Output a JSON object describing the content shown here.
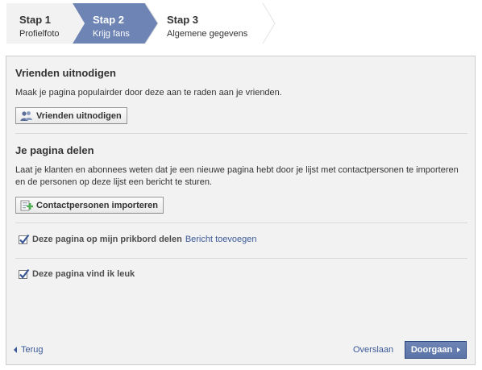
{
  "steps": [
    {
      "title": "Stap 1",
      "subtitle": "Profielfoto",
      "state": "done"
    },
    {
      "title": "Stap 2",
      "subtitle": "Krijg fans",
      "state": "active"
    },
    {
      "title": "Stap 3",
      "subtitle": "Algemene gegevens",
      "state": "upcoming"
    }
  ],
  "invite": {
    "title": "Vrienden uitnodigen",
    "text": "Maak je pagina populairder door deze aan te raden aan je vrienden.",
    "button_label": "Vrienden uitnodigen"
  },
  "share": {
    "title": "Je pagina delen",
    "text": "Laat je klanten en abonnees weten dat je een nieuwe pagina hebt door je lijst met contactpersonen te importeren en de personen op deze lijst een bericht te sturen.",
    "button_label": "Contactpersonen importeren"
  },
  "options": [
    {
      "label": "Deze pagina op mijn prikbord delen",
      "link": "Bericht toevoegen",
      "checked": true
    },
    {
      "label": "Deze pagina vind ik leuk",
      "checked": true
    }
  ],
  "footer": {
    "back_label": "Terug",
    "skip_label": "Overslaan",
    "continue_label": "Doorgaan"
  },
  "colors": {
    "accent": "#3b5998",
    "active_step": "#6d84b4",
    "panel_bg": "#f2f2f2"
  }
}
